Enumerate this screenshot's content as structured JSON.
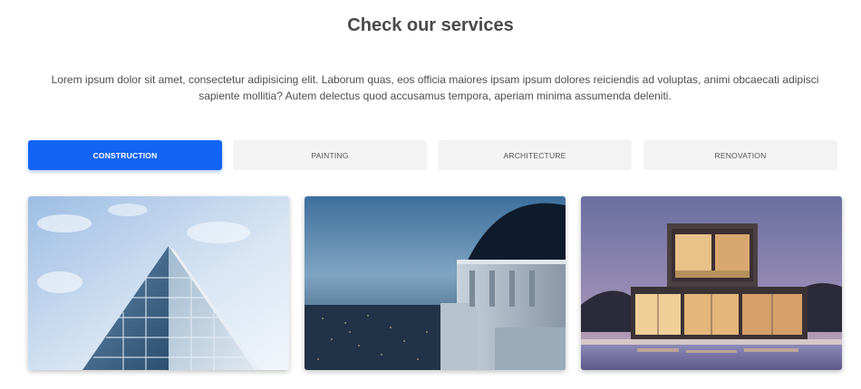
{
  "section": {
    "title": "Check our services",
    "description": "Lorem ipsum dolor sit amet, consectetur adipisicing elit. Laborum quas, eos officia maiores ipsam ipsum dolores reiciendis ad voluptas, animi obcaecati adipisci sapiente mollitia? Autem delectus quod accusamus tempora, aperiam minima assumenda deleniti."
  },
  "tabs": [
    {
      "label": "CONSTRUCTION",
      "active": true
    },
    {
      "label": "PAINTING",
      "active": false
    },
    {
      "label": "ARCHITECTURE",
      "active": false
    },
    {
      "label": "RENOVATION",
      "active": false
    }
  ],
  "colors": {
    "accent": "#1264f6",
    "tab_bg": "#f3f3f3",
    "title": "#4a4a4a"
  },
  "gallery": [
    {
      "subject": "glass-skyscraper-photo"
    },
    {
      "subject": "observatory-night-city-photo"
    },
    {
      "subject": "modern-house-pool-photo"
    }
  ]
}
